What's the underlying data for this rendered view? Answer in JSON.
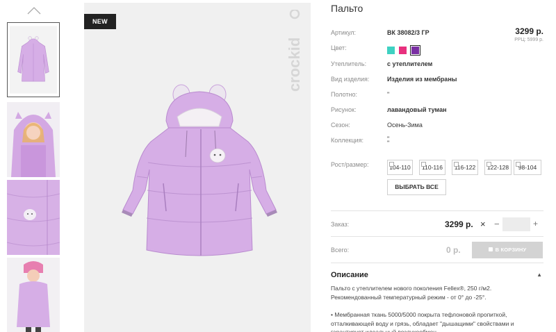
{
  "gallery": {
    "badge": "NEW",
    "brand": "crockid",
    "thumbnails": [
      "coat-front",
      "child-wearing-coat",
      "coat-detail",
      "child-full-length"
    ]
  },
  "product": {
    "title": "Пальто",
    "price": "3299 р.",
    "rrc": "РРЦ: 5999 р.",
    "attributes": [
      {
        "label": "Артикул:",
        "value": "ВК 38082/3 ГР"
      },
      {
        "label": "Цвет:",
        "value": ""
      },
      {
        "label": "Утеплитель:",
        "value": "с утеплителем"
      },
      {
        "label": "Вид изделия:",
        "value": "Изделия из мембраны"
      },
      {
        "label": "Полотно:",
        "value": "\""
      },
      {
        "label": "Рисунок:",
        "value": "лавандовый туман"
      },
      {
        "label": "Сезон:",
        "value": "Осень-Зима"
      },
      {
        "label": "Коллекция:",
        "value": "\"\n\""
      }
    ],
    "colors": [
      "#3fd1c2",
      "#e8307e",
      "#7a2fa3"
    ],
    "selected_color": 2,
    "size_label": "Рост/размер:",
    "sizes": [
      "104-110",
      "110-116",
      "116-122",
      "122-128",
      "98-104"
    ],
    "select_all_label": "ВЫБРАТЬ ВСЕ"
  },
  "order": {
    "label": "Заказ:",
    "price": "3299 р.",
    "remove": "×",
    "minus": "−",
    "quantity": "",
    "plus": "+"
  },
  "total": {
    "label": "Всего:",
    "value": "0 р.",
    "cart_button": "В КОРЗИНУ"
  },
  "description": {
    "heading": "Описание",
    "toggle": "▲",
    "paragraph1": "Пальто с утеплителем нового поколения Fellex®, 250 г/м2. Рекомендованный температурный режим - от 0° до -25°.",
    "paragraph2": "• Мембранная ткань 5000/5000 покрыта тефлоновой пропиткой, отталкивающей воду и грязь, обладает \"дышащими\" свойствами и гарантирует идеальный воздухообмен."
  },
  "colors": {
    "coat": "#d6aee6",
    "coat_shadow": "#b98bcf",
    "panel_bg": "#f0f0f0",
    "badge_bg": "#222222",
    "cart_disabled": "#d3d3d3"
  }
}
